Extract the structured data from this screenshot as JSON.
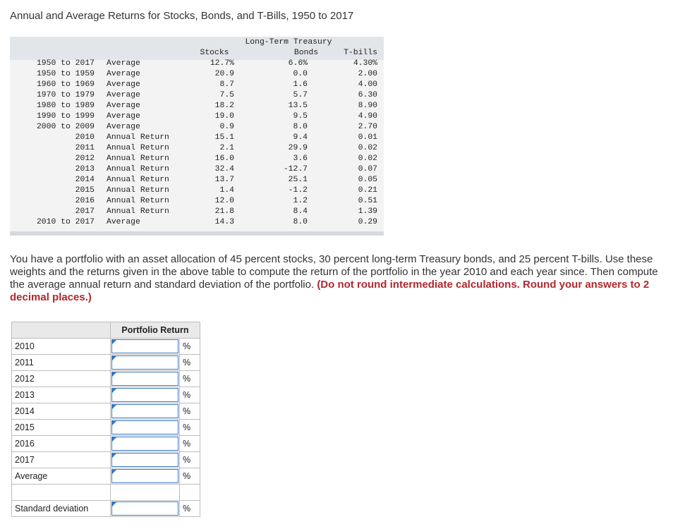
{
  "title": "Annual and Average Returns for Stocks, Bonds, and T-Bills, 1950 to 2017",
  "returns_table": {
    "headers": {
      "long_term_treasury": "Long-Term Treasury",
      "stocks": "Stocks",
      "bonds": "Bonds",
      "tbills": "T-bills"
    },
    "rows": [
      {
        "period": "1950 to 2017",
        "type": "Average",
        "stocks": "12.7%",
        "bonds": "6.6%",
        "tbills": "4.30%"
      },
      {
        "period": "1950 to 1959",
        "type": "Average",
        "stocks": "20.9",
        "bonds": "0.0",
        "tbills": "2.00"
      },
      {
        "period": "1960 to 1969",
        "type": "Average",
        "stocks": "8.7",
        "bonds": "1.6",
        "tbills": "4.00"
      },
      {
        "period": "1970 to 1979",
        "type": "Average",
        "stocks": "7.5",
        "bonds": "5.7",
        "tbills": "6.30"
      },
      {
        "period": "1980 to 1989",
        "type": "Average",
        "stocks": "18.2",
        "bonds": "13.5",
        "tbills": "8.90"
      },
      {
        "period": "1990 to 1999",
        "type": "Average",
        "stocks": "19.0",
        "bonds": "9.5",
        "tbills": "4.90"
      },
      {
        "period": "2000 to 2009",
        "type": "Average",
        "stocks": "0.9",
        "bonds": "8.0",
        "tbills": "2.70"
      },
      {
        "period": "2010",
        "type": "Annual Return",
        "stocks": "15.1",
        "bonds": "9.4",
        "tbills": "0.01"
      },
      {
        "period": "2011",
        "type": "Annual Return",
        "stocks": "2.1",
        "bonds": "29.9",
        "tbills": "0.02"
      },
      {
        "period": "2012",
        "type": "Annual Return",
        "stocks": "16.0",
        "bonds": "3.6",
        "tbills": "0.02"
      },
      {
        "period": "2013",
        "type": "Annual Return",
        "stocks": "32.4",
        "bonds": "-12.7",
        "tbills": "0.07"
      },
      {
        "period": "2014",
        "type": "Annual Return",
        "stocks": "13.7",
        "bonds": "25.1",
        "tbills": "0.05"
      },
      {
        "period": "2015",
        "type": "Annual Return",
        "stocks": "1.4",
        "bonds": "-1.2",
        "tbills": "0.21"
      },
      {
        "period": "2016",
        "type": "Annual Return",
        "stocks": "12.0",
        "bonds": "1.2",
        "tbills": "0.51"
      },
      {
        "period": "2017",
        "type": "Annual Return",
        "stocks": "21.8",
        "bonds": "8.4",
        "tbills": "1.39"
      },
      {
        "period": "2010 to 2017",
        "type": "Average",
        "stocks": "14.3",
        "bonds": "8.0",
        "tbills": "0.29"
      }
    ]
  },
  "problem": {
    "text": "You have a portfolio with an asset allocation of 45 percent stocks, 30 percent long-term Treasury bonds, and 25 percent T-bills. Use these weights and the returns given in the above table to compute the return of the portfolio in the year 2010 and each year since. Then compute the average annual return and standard deviation of the portfolio.",
    "instruction": "(Do not round intermediate calculations. Round your answers to 2 decimal places.)"
  },
  "answer_grid": {
    "header": "Portfolio Return",
    "unit": "%",
    "rows": [
      {
        "label": "2010",
        "value": ""
      },
      {
        "label": "2011",
        "value": ""
      },
      {
        "label": "2012",
        "value": ""
      },
      {
        "label": "2013",
        "value": ""
      },
      {
        "label": "2014",
        "value": ""
      },
      {
        "label": "2015",
        "value": ""
      },
      {
        "label": "2016",
        "value": ""
      },
      {
        "label": "2017",
        "value": ""
      },
      {
        "label": "Average",
        "value": ""
      }
    ],
    "std_label": "Standard deviation",
    "std_value": ""
  }
}
